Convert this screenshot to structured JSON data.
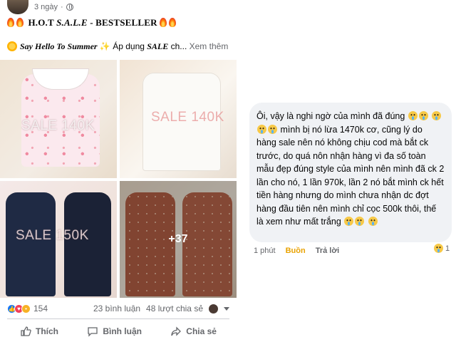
{
  "post": {
    "timestamp": "3 ngày",
    "separator": "·",
    "title": {
      "prefix": "H.O.T ",
      "sale": "S.A.L.E",
      "suffix": " - BESTSELLER"
    },
    "subtitle": {
      "hello": "Say Hello To Summer",
      "text_before_sale": " Áp dụng ",
      "sale_word": "SALE",
      "text_after": " ch...",
      "see_more": "Xem thêm"
    },
    "gallery": {
      "watermarks": [
        "SALE 140K",
        "SALE 140K",
        "SALE 150K"
      ],
      "more_count": "+37"
    },
    "stats": {
      "reactions_count": "154",
      "comments": "23 bình luận",
      "shares": "48 lượt chia sẻ"
    },
    "actions": {
      "like": "Thích",
      "comment": "Bình luận",
      "share": "Chia sẻ"
    }
  },
  "comment": {
    "text_1": "Ôi, vậy là nghi ngờ của mình đã đúng",
    "text_2": "mình bị nó lừa 1470k cơ, cũng lý do hàng sale nên nó không chịu cod mà bắt ck trước, do quá nôn nhận hàng vì đa số toàn mẫu đẹp đúng style của mình nên mình đã ck 2 lần cho nó, 1 lần 970k, lần 2 nó bắt mình ck hết tiền hàng nhưng do mình chưa nhận dc đợt hàng đầu tiên nên mình chỉ cọc 500k thôi, thế là xem như mất trắng",
    "time": "1 phút",
    "reaction_label": "Buồn",
    "reply": "Trả lời",
    "reaction_count": "1"
  },
  "colors": {
    "link_blue": "#1877f2",
    "sad_reaction": "#e9a200",
    "muted_text": "#65676b",
    "bubble_bg": "#f0f2f5"
  },
  "icons": [
    "globe-icon",
    "fire-icon",
    "sun-icon",
    "sparkle-icon",
    "like-icon",
    "love-icon",
    "wow-icon",
    "comment-icon",
    "share-icon",
    "crying-emoji-icon",
    "sad-emoji-icon"
  ]
}
